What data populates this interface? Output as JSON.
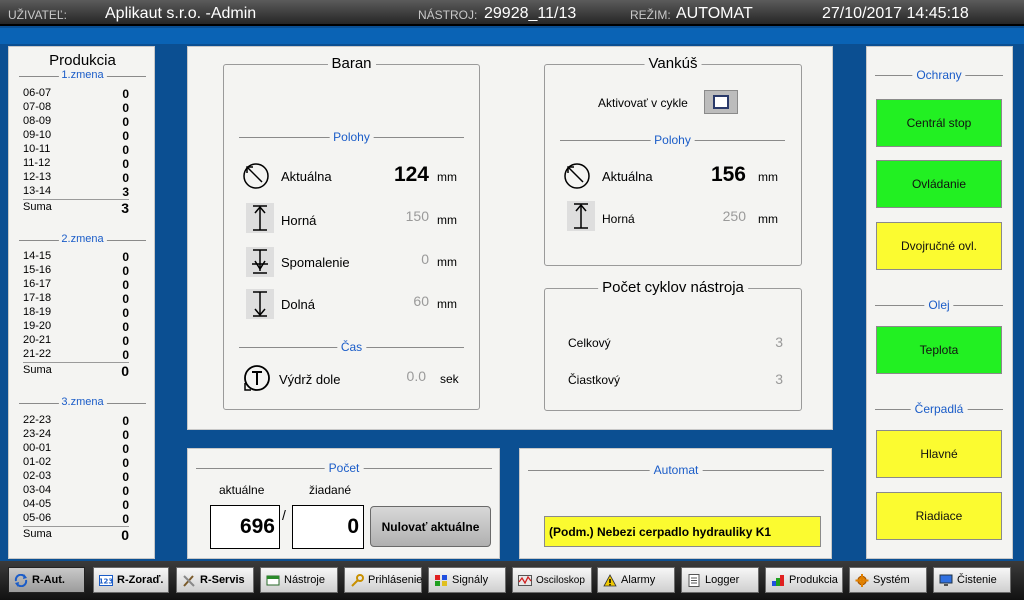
{
  "header": {
    "user_label": "UŽIVATEĽ:",
    "user_value": "Aplikaut s.r.o. -Admin",
    "tool_label": "NÁSTROJ:",
    "tool_value": "29928_11/13",
    "mode_label": "REŽIM:",
    "mode_value": "AUTOMAT",
    "datetime": "27/10/2017 14:45:18"
  },
  "production": {
    "title": "Produkcia",
    "sum_label": "Suma",
    "shifts": [
      {
        "name": "1.zmena",
        "rows": [
          {
            "time": "06-07",
            "count": "0"
          },
          {
            "time": "07-08",
            "count": "0"
          },
          {
            "time": "08-09",
            "count": "0"
          },
          {
            "time": "09-10",
            "count": "0"
          },
          {
            "time": "10-11",
            "count": "0"
          },
          {
            "time": "11-12",
            "count": "0"
          },
          {
            "time": "12-13",
            "count": "0"
          },
          {
            "time": "13-14",
            "count": "3"
          }
        ],
        "sum": "3"
      },
      {
        "name": "2.zmena",
        "rows": [
          {
            "time": "14-15",
            "count": "0"
          },
          {
            "time": "15-16",
            "count": "0"
          },
          {
            "time": "16-17",
            "count": "0"
          },
          {
            "time": "17-18",
            "count": "0"
          },
          {
            "time": "18-19",
            "count": "0"
          },
          {
            "time": "19-20",
            "count": "0"
          },
          {
            "time": "20-21",
            "count": "0"
          },
          {
            "time": "21-22",
            "count": "0"
          }
        ],
        "sum": "0"
      },
      {
        "name": "3.zmena",
        "rows": [
          {
            "time": "22-23",
            "count": "0"
          },
          {
            "time": "23-24",
            "count": "0"
          },
          {
            "time": "00-01",
            "count": "0"
          },
          {
            "time": "01-02",
            "count": "0"
          },
          {
            "time": "02-03",
            "count": "0"
          },
          {
            "time": "03-04",
            "count": "0"
          },
          {
            "time": "04-05",
            "count": "0"
          },
          {
            "time": "05-06",
            "count": "0"
          }
        ],
        "sum": "0"
      }
    ]
  },
  "baran": {
    "title": "Baran",
    "positions_label": "Polohy",
    "actual_label": "Aktuálna",
    "actual_value": "124",
    "upper_label": "Horná",
    "upper_value": "150",
    "slowdown_label": "Spomalenie",
    "slowdown_value": "0",
    "lower_label": "Dolná",
    "lower_value": "60",
    "unit_mm": "mm",
    "time_label": "Čas",
    "dwell_label": "Výdrž dole",
    "dwell_value": "0.0",
    "unit_sec": "sek"
  },
  "vankus": {
    "title": "Vankúš",
    "activate_label": "Aktivovať v cykle",
    "activate_checked": false,
    "positions_label": "Polohy",
    "actual_label": "Aktuálna",
    "actual_value": "156",
    "upper_label": "Horná",
    "upper_value": "250",
    "unit_mm": "mm"
  },
  "cycles": {
    "title": "Počet cyklov nástroja",
    "total_label": "Celkový",
    "total_value": "3",
    "partial_label": "Čiastkový",
    "partial_value": "3"
  },
  "count": {
    "title": "Počet",
    "current_label": "aktuálne",
    "target_label": "žiadané",
    "current_value": "696",
    "target_value": "0",
    "separator": "/",
    "reset_label": "Nulovať aktuálne"
  },
  "automat": {
    "title": "Automat",
    "message": "(Podm.) Nebezi cerpadlo hydrauliky K1"
  },
  "status": {
    "protections_label": "Ochrany",
    "central_stop": "Centrál stop",
    "controls": "Ovládanie",
    "two_hand": "Dvojručné ovl.",
    "oil_label": "Olej",
    "temperature": "Teplota",
    "pumps_label": "Čerpadlá",
    "main_pump": "Hlavné",
    "control_pump": "Riadiace"
  },
  "colors": {
    "ok": "#22f022",
    "warning": "#fbfb30",
    "background": "#0b4f92",
    "accent": "#1a5cc8"
  },
  "taskbar": [
    {
      "label": "R-Aut.",
      "icon": "refresh-icon"
    },
    {
      "label": "R-Zoraď.",
      "icon": "numbers-icon"
    },
    {
      "label": "R-Servis",
      "icon": "tools-icon"
    },
    {
      "label": "Nástroje",
      "icon": "window-icon"
    },
    {
      "label": "Prihlásenie",
      "icon": "key-icon"
    },
    {
      "label": "Signály",
      "icon": "signal-icon"
    },
    {
      "label": "Osciloskop",
      "icon": "oscilloscope-icon"
    },
    {
      "label": "Alarmy",
      "icon": "warning-icon"
    },
    {
      "label": "Logger",
      "icon": "document-icon"
    },
    {
      "label": "Produkcia",
      "icon": "production-icon"
    },
    {
      "label": "Systém",
      "icon": "gear-icon"
    },
    {
      "label": "Čistenie",
      "icon": "monitor-icon"
    }
  ]
}
